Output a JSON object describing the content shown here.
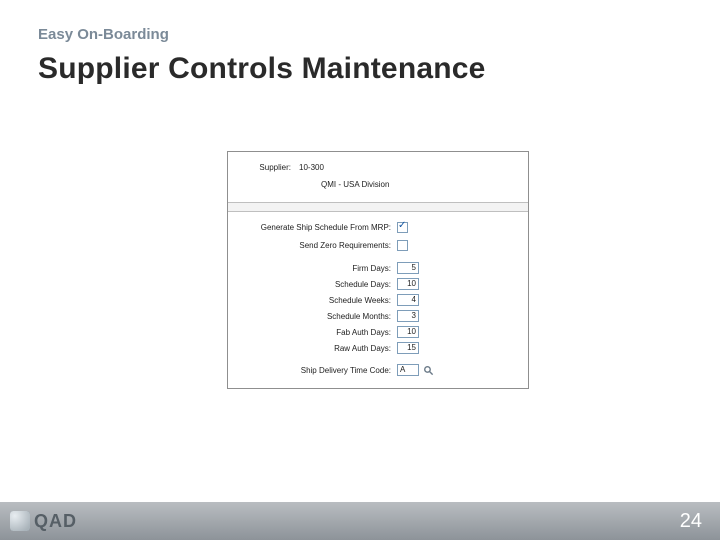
{
  "slide": {
    "kicker": "Easy On-Boarding",
    "title": "Supplier Controls Maintenance",
    "page": "24"
  },
  "logo": {
    "text": "QAD"
  },
  "form": {
    "header": {
      "supplier_label": "Supplier:",
      "supplier_value": "10-300",
      "desc_value": "QMI - USA Division"
    },
    "opts": {
      "gen_mrp_label": "Generate Ship Schedule From MRP:",
      "gen_mrp_checked": true,
      "send_zero_label": "Send Zero Requirements:",
      "send_zero_checked": false
    },
    "nums": {
      "firm_days_label": "Firm Days:",
      "firm_days": "5",
      "sched_days_label": "Schedule Days:",
      "sched_days": "10",
      "sched_weeks_label": "Schedule Weeks:",
      "sched_weeks": "4",
      "sched_months_label": "Schedule Months:",
      "sched_months": "3",
      "fab_auth_label": "Fab Auth Days:",
      "fab_auth": "10",
      "raw_auth_label": "Raw Auth Days:",
      "raw_auth": "15"
    },
    "ship_time": {
      "label": "Ship Delivery Time Code:",
      "value": "A"
    }
  }
}
